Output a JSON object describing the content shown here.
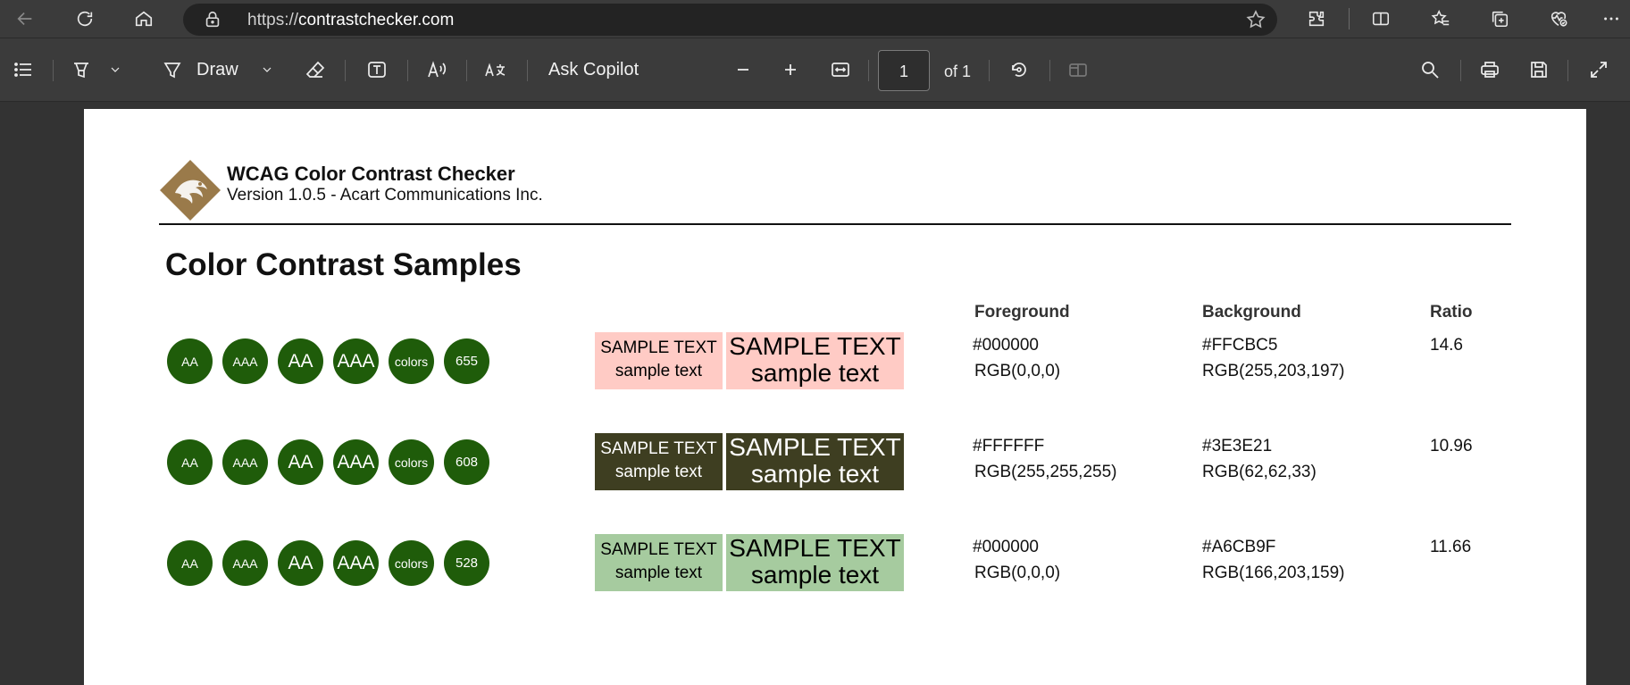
{
  "browser": {
    "url_prefix": "https://",
    "url_domain": "contrastchecker.com"
  },
  "pdf_toolbar": {
    "draw_label": "Draw",
    "ask_copilot_label": "Ask Copilot",
    "page_current": "1",
    "page_of": "of 1"
  },
  "document": {
    "app_title": "WCAG Color Contrast Checker",
    "app_version": "Version 1.0.5 - Acart Communications Inc.",
    "title": "Color Contrast Samples",
    "headers": {
      "foreground": "Foreground",
      "background": "Background",
      "ratio": "Ratio"
    },
    "badge_color": "#1f5c0a",
    "rows": [
      {
        "badges": [
          "AA",
          "AAA",
          "AA",
          "AAA",
          "colors",
          "655"
        ],
        "sample_upper": "SAMPLE TEXT",
        "sample_lower": "sample text",
        "fg_hex": "#000000",
        "fg_rgb": "RGB(0,0,0)",
        "bg_hex": "#FFCBC5",
        "bg_rgb": "RGB(255,203,197)",
        "ratio": "14.6",
        "fg_color": "#000000",
        "bg_color": "#FFCBC5"
      },
      {
        "badges": [
          "AA",
          "AAA",
          "AA",
          "AAA",
          "colors",
          "608"
        ],
        "sample_upper": "SAMPLE TEXT",
        "sample_lower": "sample text",
        "fg_hex": "#FFFFFF",
        "fg_rgb": "RGB(255,255,255)",
        "bg_hex": "#3E3E21",
        "bg_rgb": "RGB(62,62,33)",
        "ratio": "10.96",
        "fg_color": "#FFFFFF",
        "bg_color": "#3E3E21"
      },
      {
        "badges": [
          "AA",
          "AAA",
          "AA",
          "AAA",
          "colors",
          "528"
        ],
        "sample_upper": "SAMPLE TEXT",
        "sample_lower": "sample text",
        "fg_hex": "#000000",
        "fg_rgb": "RGB(0,0,0)",
        "bg_hex": "#A6CB9F",
        "bg_rgb": "RGB(166,203,159)",
        "ratio": "11.66",
        "fg_color": "#000000",
        "bg_color": "#A6CB9F"
      }
    ]
  }
}
